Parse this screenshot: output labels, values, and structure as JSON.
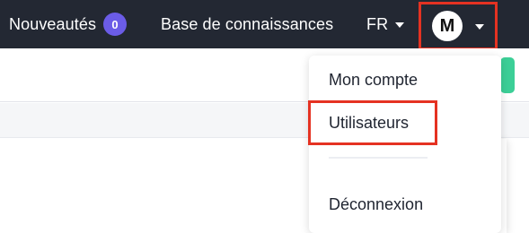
{
  "navbar": {
    "news_label": "Nouveautés",
    "news_count": "0",
    "knowledge_base_label": "Base de connaissances",
    "language": "FR",
    "user_initial": "M"
  },
  "user_menu": {
    "items": [
      {
        "label": "Mon compte"
      },
      {
        "label": "Utilisateurs"
      },
      {
        "label": "Déconnexion"
      }
    ]
  },
  "colors": {
    "navbar_bg": "#232833",
    "badge": "#6b5ce7",
    "highlight_box": "#e53222",
    "accent_green": "#3ccf97"
  }
}
